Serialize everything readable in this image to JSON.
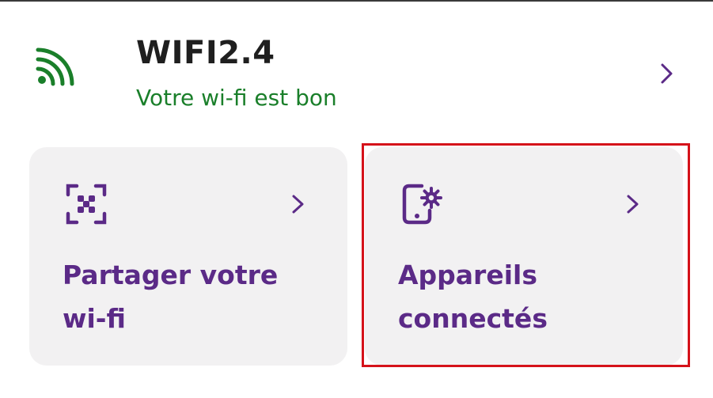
{
  "wifi": {
    "name": "WIFI2.4",
    "status": "Votre wi-fi est bon",
    "icon": "wifi-signal-icon",
    "status_color": "#1a7f2a"
  },
  "cards": [
    {
      "label_line1": "Partager votre",
      "label_line2": "wi-fi",
      "icon": "qr-scan-icon"
    },
    {
      "label_line1": "Appareils",
      "label_line2": "connectés",
      "icon": "device-settings-icon"
    }
  ],
  "colors": {
    "accent": "#5b2a87",
    "card_background": "#f2f1f2",
    "highlight": "#d5121a"
  }
}
